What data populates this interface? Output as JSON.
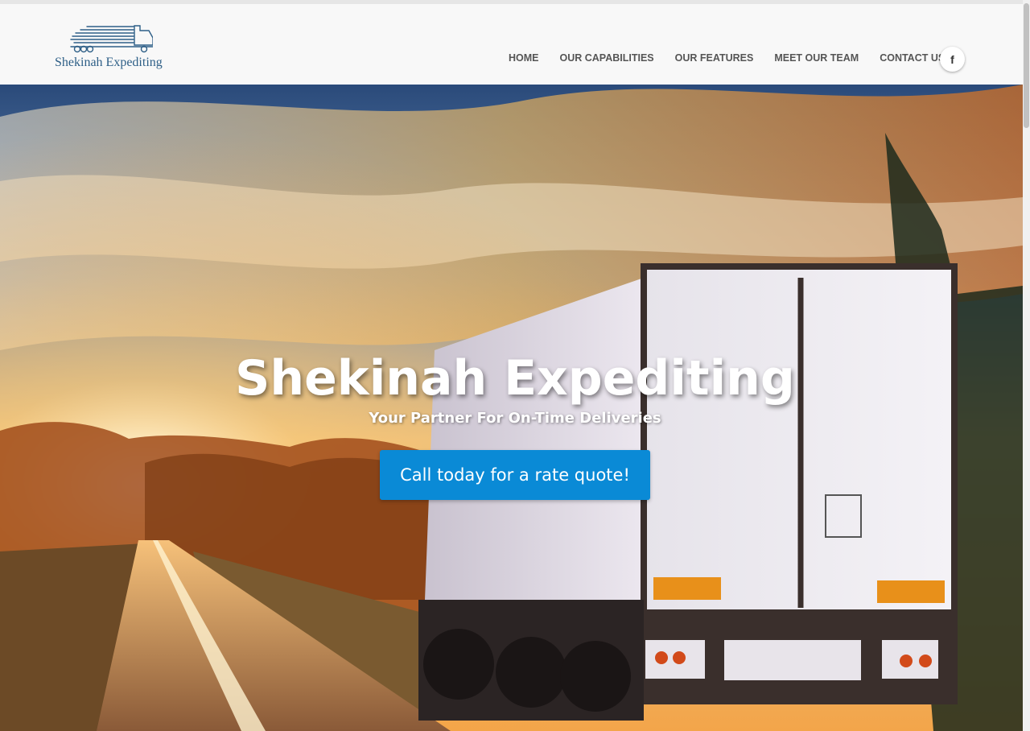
{
  "brand": {
    "name": "Shekinah Expediting",
    "logo_icon": "truck-icon"
  },
  "nav": {
    "items": [
      {
        "label": "HOME"
      },
      {
        "label": "OUR CAPABILITIES"
      },
      {
        "label": "OUR FEATURES"
      },
      {
        "label": "MEET OUR TEAM"
      },
      {
        "label": "CONTACT US"
      }
    ],
    "social": {
      "icon": "facebook-icon",
      "glyph": "f"
    }
  },
  "hero": {
    "title": "Shekinah Expediting",
    "subtitle": "Your Partner For On-Time Deliveries",
    "cta_label": "Call today for a rate quote!",
    "image": "truck on road at sunset"
  },
  "colors": {
    "brand_blue": "#2e5f87",
    "cta_blue": "#0a8ad6",
    "nav_text": "#555555",
    "header_bg": "#f8f8f8"
  }
}
